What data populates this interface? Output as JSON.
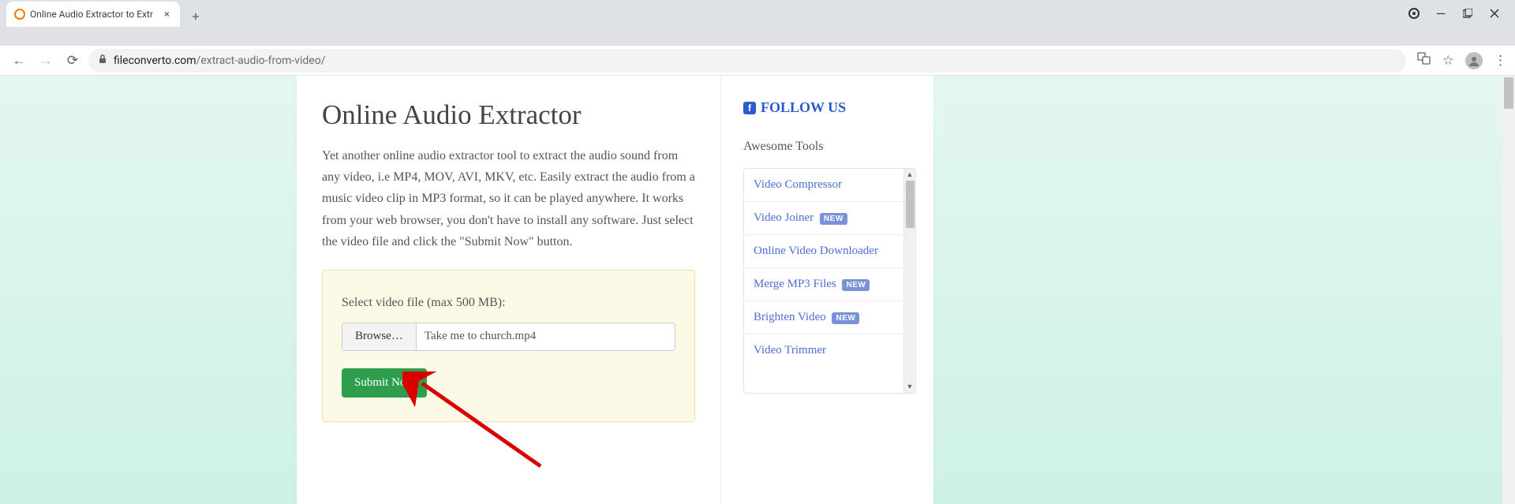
{
  "browser": {
    "tab_title": "Online Audio Extractor to Extr",
    "url_domain": "fileconverto.com",
    "url_path": "/extract-audio-from-video/"
  },
  "main": {
    "heading": "Online Audio Extractor",
    "description": "Yet another online audio extractor tool to extract the audio sound from any video, i.e MP4, MOV, AVI, MKV, etc. Easily extract the audio from a music video clip in MP3 format, so it can be played anywhere. It works from your web browser, you don't have to install any software. Just select the video file and click the \"Submit Now\" button.",
    "upload_label": "Select video file (max 500 MB):",
    "browse_label": "Browse…",
    "selected_file": "Take me to church.mp4",
    "submit_label": "Submit Now"
  },
  "sidebar": {
    "follow_label": "FOLLOW US",
    "tools_heading": "Awesome Tools",
    "new_badge": "NEW",
    "tools": [
      {
        "label": "Video Compressor",
        "new": false
      },
      {
        "label": "Video Joiner",
        "new": true
      },
      {
        "label": "Online Video Downloader",
        "new": false
      },
      {
        "label": "Merge MP3 Files",
        "new": true
      },
      {
        "label": "Brighten Video",
        "new": true
      },
      {
        "label": "Video Trimmer",
        "new": false
      }
    ]
  }
}
